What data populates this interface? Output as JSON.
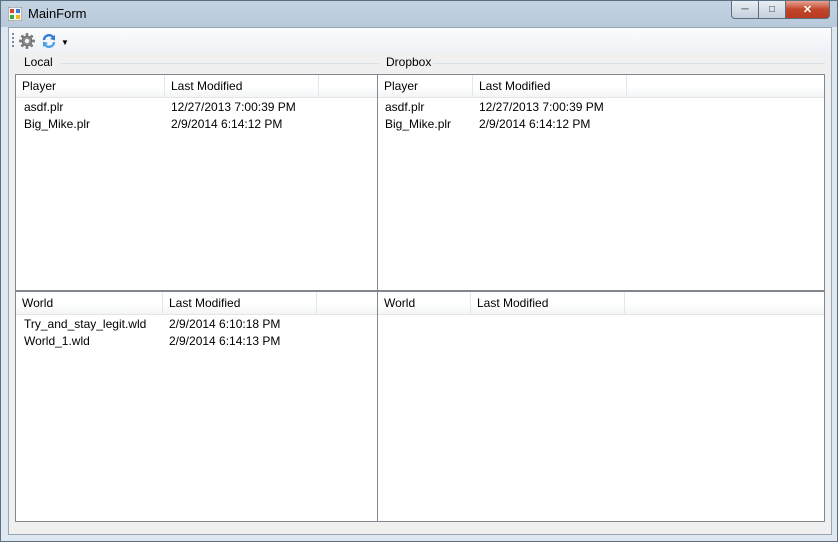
{
  "window": {
    "title": "MainForm"
  },
  "toolbar": {
    "settings_icon": "gear-icon",
    "sync_icon": "refresh-icon",
    "dropdown_icon": "caret-down-icon"
  },
  "local": {
    "label": "Local",
    "players": {
      "columns": [
        "Player",
        "Last Modified",
        ""
      ],
      "rows": [
        {
          "name": "asdf.plr",
          "modified": "12/27/2013 7:00:39 PM"
        },
        {
          "name": "Big_Mike.plr",
          "modified": "2/9/2014 6:14:12 PM"
        }
      ]
    },
    "worlds": {
      "columns": [
        "World",
        "Last Modified",
        ""
      ],
      "rows": [
        {
          "name": "Try_and_stay_legit.wld",
          "modified": "2/9/2014 6:10:18 PM"
        },
        {
          "name": "World_1.wld",
          "modified": "2/9/2014 6:14:13 PM"
        }
      ]
    }
  },
  "dropbox": {
    "label": "Dropbox",
    "players": {
      "columns": [
        "Player",
        "Last Modified",
        ""
      ],
      "rows": [
        {
          "name": "asdf.plr",
          "modified": "12/27/2013 7:00:39 PM"
        },
        {
          "name": "Big_Mike.plr",
          "modified": "2/9/2014 6:14:12 PM"
        }
      ]
    },
    "worlds": {
      "columns": [
        "World",
        "Last Modified",
        ""
      ],
      "rows": []
    }
  }
}
